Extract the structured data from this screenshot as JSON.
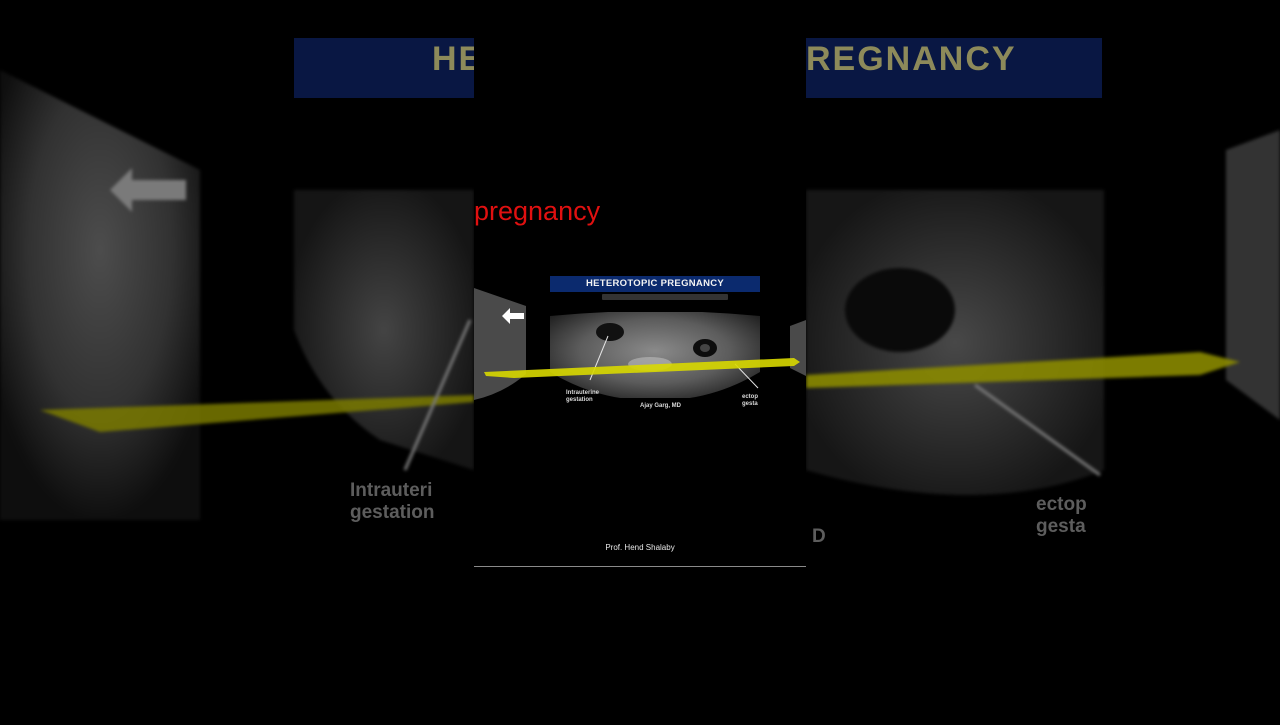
{
  "slide": {
    "heading_visible": "pregnancy",
    "banner": "HETEROTOPIC PREGNANCY",
    "label_intrauterine": "Intrauterine gestation",
    "label_intrauterine_line1": "Intrauterine",
    "label_intrauterine_line2": "gestation",
    "label_ectopic_line1": "ectop",
    "label_ectopic_line2": "gesta",
    "author": "Ajay Garg, MD",
    "credit": "Prof. Hend Shalaby"
  },
  "background": {
    "title_left": "HE",
    "title_right": "REGNANCY",
    "label_left_line1": "Intrauteri",
    "label_left_line2": "gestation",
    "label_right_line1": "ectop",
    "label_right_line2": "gesta",
    "label_right_author": "D"
  },
  "colors": {
    "heading": "#e01010",
    "banner_bg": "#0b2a6e",
    "highlight_stroke": "#d8d800"
  }
}
